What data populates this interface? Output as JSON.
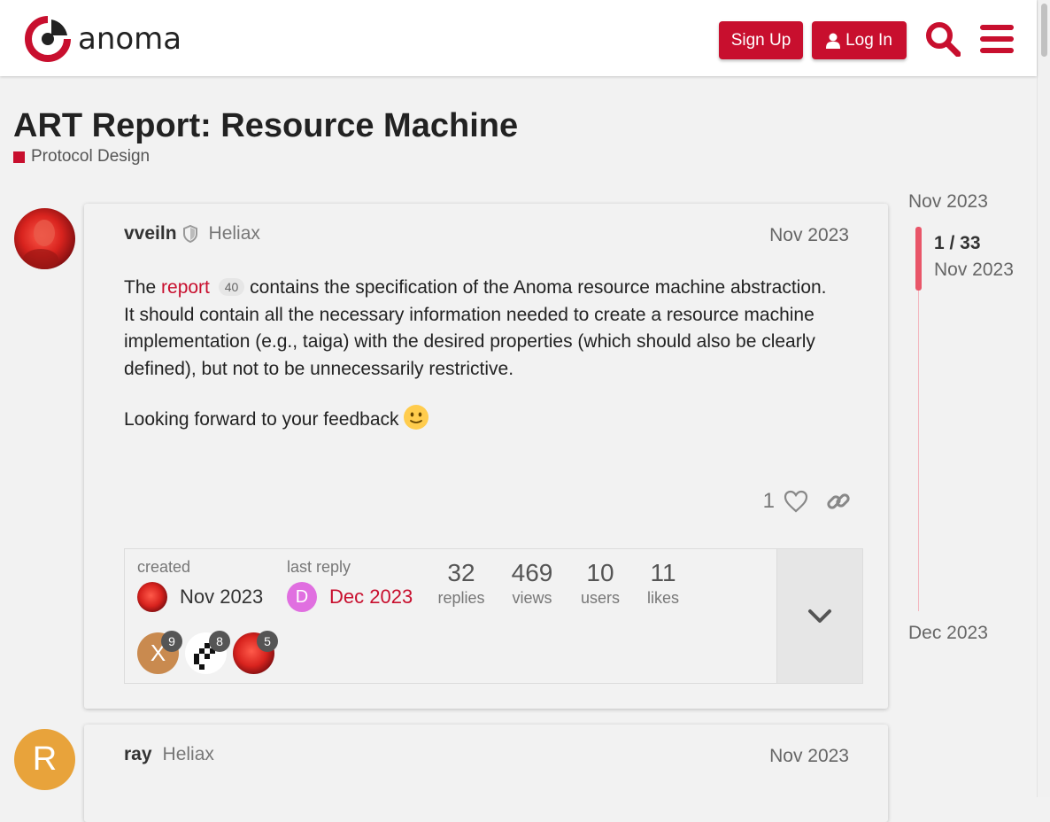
{
  "header": {
    "brand": "anoma",
    "signup_label": "Sign Up",
    "login_label": "Log In",
    "accent_color": "#c80f2e",
    "icons": [
      "search-icon",
      "hamburger-menu-icon",
      "user-icon"
    ]
  },
  "topic": {
    "title": "ART Report: Resource Machine",
    "category": "Protocol Design"
  },
  "posts": [
    {
      "username": "vveiln",
      "user_title": "Heliax",
      "date": "Nov 2023",
      "link_text": "report",
      "link_clicks": "40",
      "body_intro": "The ",
      "body_rest": " contains the specification of the Anoma resource machine abstraction. It should contain all the necessary information needed to create a resource machine implementation (e.g., taiga) with the desired properties (which should also be clearly defined), but not to be unnecessarily restrictive.",
      "body_p2": "Looking forward to your feedback",
      "likes": "1"
    },
    {
      "username": "ray",
      "user_title": "Heliax",
      "date": "Nov 2023",
      "avatar_letter": "R"
    }
  ],
  "topic_map": {
    "created_label": "created",
    "created_date": "Nov 2023",
    "last_reply_label": "last reply",
    "last_reply_date": "Dec 2023",
    "last_reply_avatar_letter": "D",
    "stats": [
      {
        "num": "32",
        "label": "replies"
      },
      {
        "num": "469",
        "label": "views"
      },
      {
        "num": "10",
        "label": "users"
      },
      {
        "num": "11",
        "label": "likes"
      }
    ],
    "participants": [
      {
        "letter": "X",
        "count": "9"
      },
      {
        "letter": "",
        "count": "8"
      },
      {
        "letter": "",
        "count": "5"
      }
    ]
  },
  "timeline": {
    "start_date": "Nov 2023",
    "position": "1 / 33",
    "position_date": "Nov 2023",
    "end_date": "Dec 2023"
  }
}
